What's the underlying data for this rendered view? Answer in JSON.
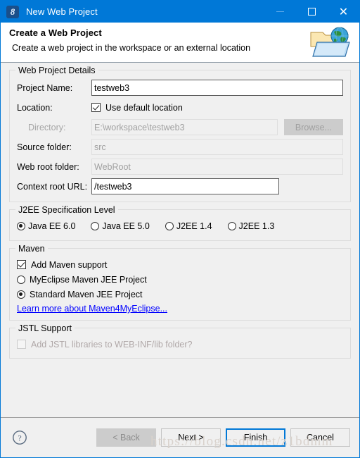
{
  "window": {
    "title": "New Web Project",
    "icon": "myeclipse-logo-icon",
    "minimize_label": "Minimize",
    "maximize_label": "Maximize",
    "close_label": "Close"
  },
  "header": {
    "title": "Create a Web Project",
    "subtitle": "Create a web project in the workspace or an external location",
    "icon": "web-folder-globe-icon"
  },
  "web_project_details": {
    "group_title": "Web Project Details",
    "project_name_label": "Project Name:",
    "project_name_value": "testweb3",
    "location_label": "Location:",
    "use_default_location_label": "Use default location",
    "use_default_location_checked": true,
    "directory_label": "Directory:",
    "directory_value": "E:\\workspace\\testweb3",
    "browse_label": "Browse...",
    "source_folder_label": "Source folder:",
    "source_folder_value": "src",
    "web_root_folder_label": "Web root folder:",
    "web_root_folder_value": "WebRoot",
    "context_root_label": "Context root URL:",
    "context_root_value": "/testweb3"
  },
  "j2ee": {
    "group_title": "J2EE Specification Level",
    "options": [
      {
        "label": "Java EE 6.0",
        "selected": true
      },
      {
        "label": "Java EE 5.0",
        "selected": false
      },
      {
        "label": "J2EE 1.4",
        "selected": false
      },
      {
        "label": "J2EE 1.3",
        "selected": false
      }
    ]
  },
  "maven": {
    "group_title": "Maven",
    "add_support_label": "Add Maven support",
    "add_support_checked": true,
    "options": [
      {
        "label": "MyEclipse Maven JEE Project",
        "selected": false
      },
      {
        "label": "Standard Maven JEE Project",
        "selected": true
      }
    ],
    "link_label": "Learn more about Maven4MyEclipse...",
    "link_color": "#0000ff"
  },
  "jstl": {
    "group_title": "JSTL Support",
    "checkbox_label": "Add JSTL libraries to WEB-INF/lib folder?",
    "checked": false,
    "disabled": true
  },
  "footer": {
    "help_icon": "help-question-icon",
    "buttons": [
      {
        "label": "< Back",
        "state": "disabled"
      },
      {
        "label": "Next >",
        "state": "enabled"
      },
      {
        "label": "Finish",
        "state": "default"
      },
      {
        "label": "Cancel",
        "state": "enabled"
      }
    ]
  },
  "watermark": {
    "text": "https://blog.csdn.net/z1bdmm"
  },
  "colors": {
    "titlebar": "#0078d7",
    "dialog_bg": "#f0f0f0",
    "accent": "#0078d7"
  }
}
